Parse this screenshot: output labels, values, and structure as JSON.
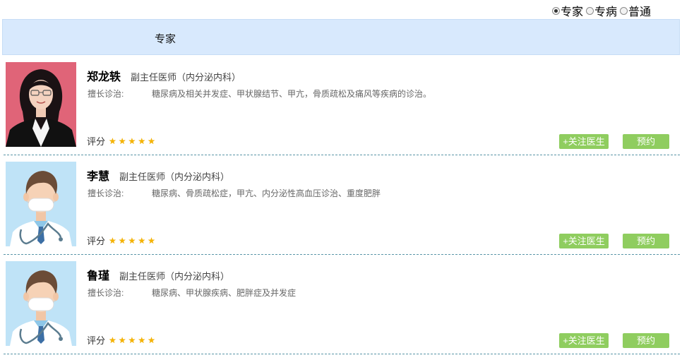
{
  "filter": {
    "options": [
      {
        "label": "专家",
        "checked": true
      },
      {
        "label": "专病",
        "checked": false
      },
      {
        "label": "普通",
        "checked": false
      }
    ]
  },
  "section": {
    "title": "专家"
  },
  "common": {
    "specialty_label": "擅长诊治:",
    "rating_label": "评分",
    "follow_label": "+关注医生",
    "book_label": "预约"
  },
  "doctors": [
    {
      "name": "郑龙轶",
      "title": "副主任医师（内分泌内科）",
      "specialty": "糖尿病及相关并发症、甲状腺结节、甲亢，骨质疏松及痛风等疾病的诊治。",
      "stars": 5,
      "photo": "portrait-female"
    },
    {
      "name": "李慧",
      "title": "副主任医师（内分泌内科）",
      "specialty": "糖尿病、骨质疏松症，甲亢、内分泌性高血压诊治、重度肥胖",
      "stars": 5,
      "photo": "doctor-avatar"
    },
    {
      "name": "鲁瑾",
      "title": "副主任医师（内分泌内科）",
      "specialty": "糖尿病、甲状腺疾病、肥胖症及并发症",
      "stars": 5,
      "photo": "doctor-avatar"
    }
  ],
  "colors": {
    "header_bg": "#d8e9fd",
    "button_green": "#8fcd5f",
    "star": "#f5b301",
    "divider": "#5a95a8"
  }
}
